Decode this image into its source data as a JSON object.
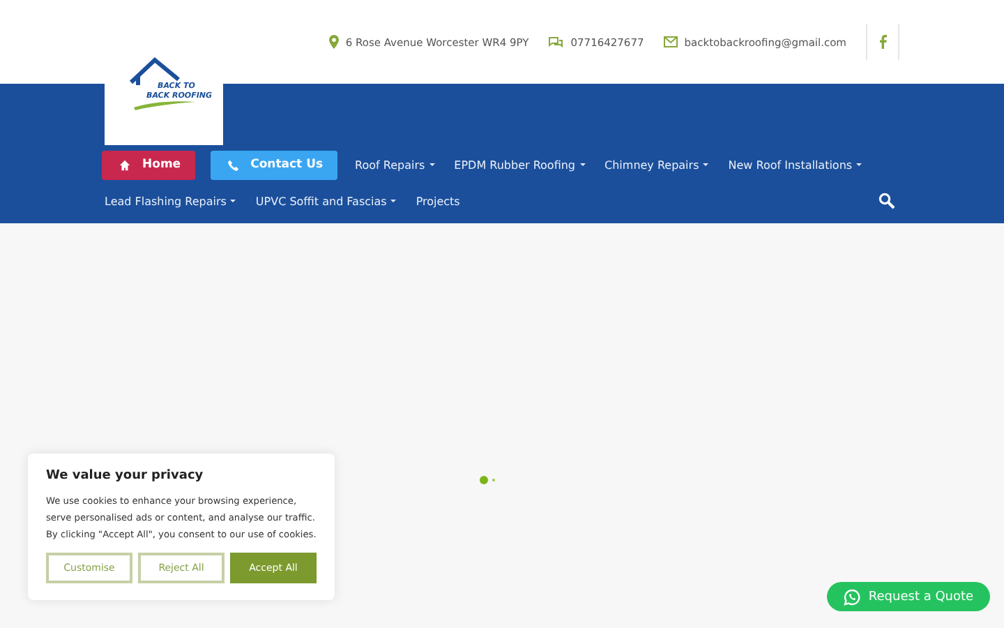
{
  "topbar": {
    "address": "6 Rose Avenue Worcester WR4 9PY",
    "phone": "07716427677",
    "email": "backtobackroofing@gmail.com"
  },
  "logo": {
    "lines": [
      "BACK TO",
      "BACK ROOFING"
    ]
  },
  "nav": {
    "rows": [
      [
        {
          "kind": "button",
          "label": "Home",
          "color": "#c8284e"
        },
        {
          "kind": "button",
          "label": "Contact Us",
          "color": "#3aa6f2"
        },
        {
          "kind": "link",
          "label": "Roof Repairs",
          "submenu": true
        },
        {
          "kind": "link",
          "label": "EPDM Rubber Roofing",
          "submenu": true
        },
        {
          "kind": "link",
          "label": "Chimney Repairs",
          "submenu": true
        },
        {
          "kind": "link",
          "label": "New Roof Installations",
          "submenu": true
        }
      ],
      [
        {
          "kind": "link",
          "label": "Lead Flashing Repairs",
          "submenu": true
        },
        {
          "kind": "link",
          "label": "UPVC Soffit and Fascias",
          "submenu": true
        },
        {
          "kind": "link",
          "label": "Projects",
          "submenu": false
        }
      ]
    ]
  },
  "cookie": {
    "title": "We value your privacy",
    "text": "We use cookies to enhance your browsing experience, serve personalised ads or content, and analyse our traffic. By clicking \"Accept All\", you consent to our use of cookies.",
    "buttons": [
      {
        "label": "Customise",
        "kind": "outline"
      },
      {
        "label": "Reject All",
        "kind": "outline"
      },
      {
        "label": "Accept All",
        "kind": "filled"
      }
    ]
  },
  "quote_button": "Request a Quote"
}
